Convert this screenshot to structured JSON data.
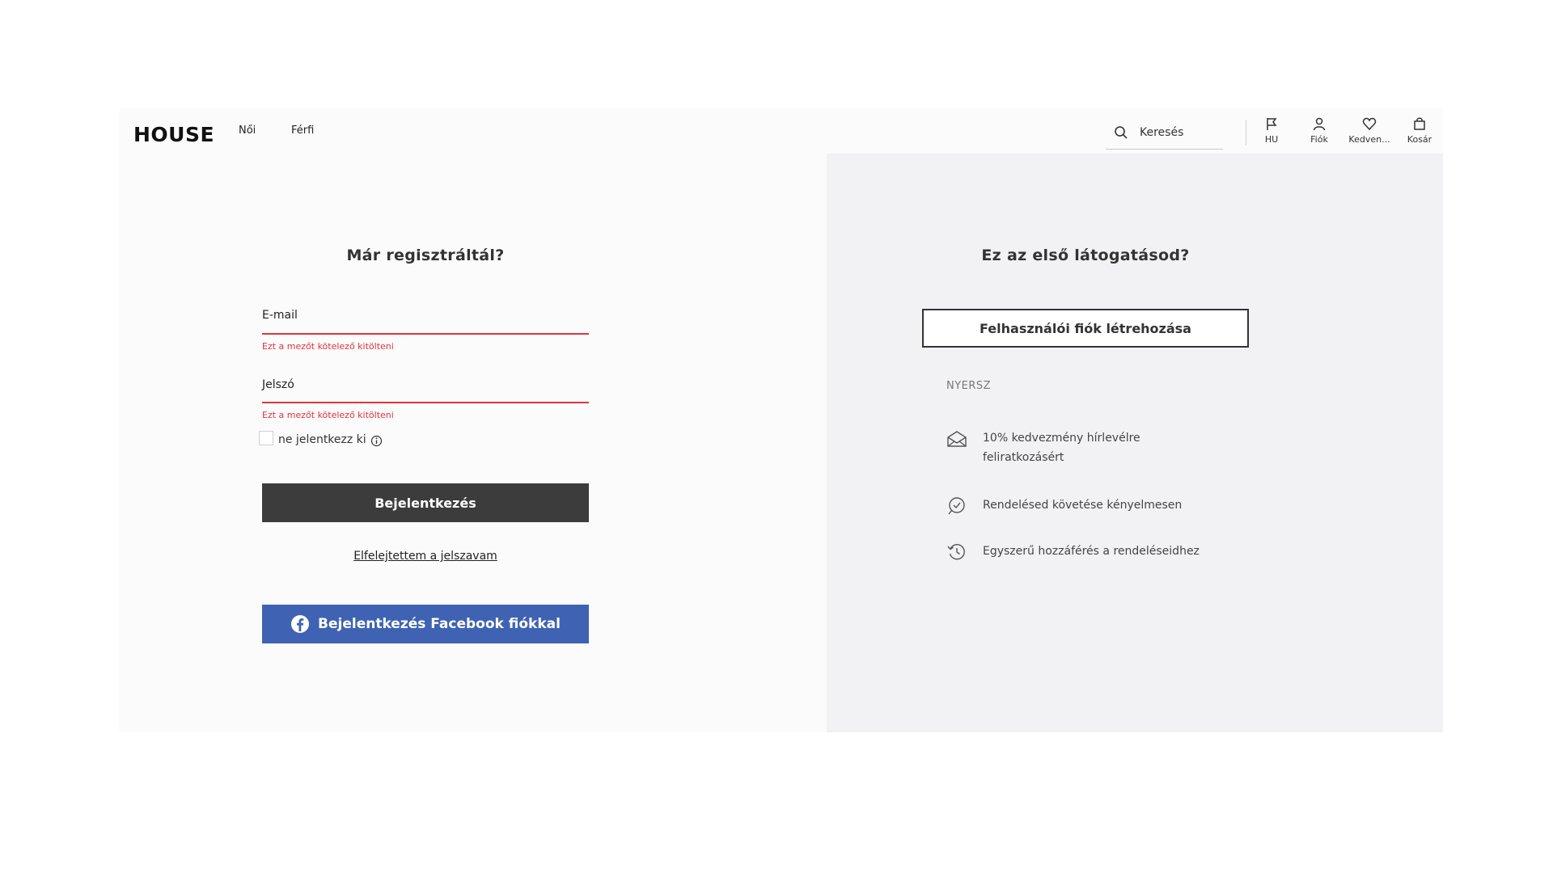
{
  "header": {
    "logo": "HOUSE",
    "nav": [
      "Női",
      "Férfi"
    ],
    "search": {
      "placeholder": "Keresés"
    },
    "icons": [
      {
        "name": "flag-icon",
        "label": "HU"
      },
      {
        "name": "account-icon",
        "label": "Fiók"
      },
      {
        "name": "heart-icon",
        "label": "Kedven..."
      },
      {
        "name": "bag-icon",
        "label": "Kosár"
      }
    ]
  },
  "login": {
    "title": "Már regisztráltál?",
    "email_label": "E-mail",
    "email_error": "Ezt a mezőt kötelező kitölteni",
    "password_label": "Jelszó",
    "password_error": "Ezt a mezőt kötelező kitölteni",
    "remember_label": "ne jelentkezz ki",
    "submit_label": "Bejelentkezés",
    "forgot_label": "Elfelejtettem a jelszavam",
    "facebook_label": "Bejelentkezés Facebook fiókkal"
  },
  "register": {
    "title": "Ez az első látogatásod?",
    "create_label": "Felhasználói fiók létrehozása",
    "benefits_title": "NYERSZ",
    "benefits": [
      {
        "icon": "envelope-icon",
        "text": "10% kedvezmény hírlevélre feliratkozásért"
      },
      {
        "icon": "check-circle-icon",
        "text": "Rendelésed követése kényelmesen"
      },
      {
        "icon": "history-icon",
        "text": "Egyszerű hozzáférés a rendeléseidhez"
      }
    ]
  },
  "colors": {
    "error": "#e0343b",
    "login_button": "#3c3c3c",
    "facebook_button": "#3f63b2",
    "right_panel": "#f2f2f4"
  }
}
